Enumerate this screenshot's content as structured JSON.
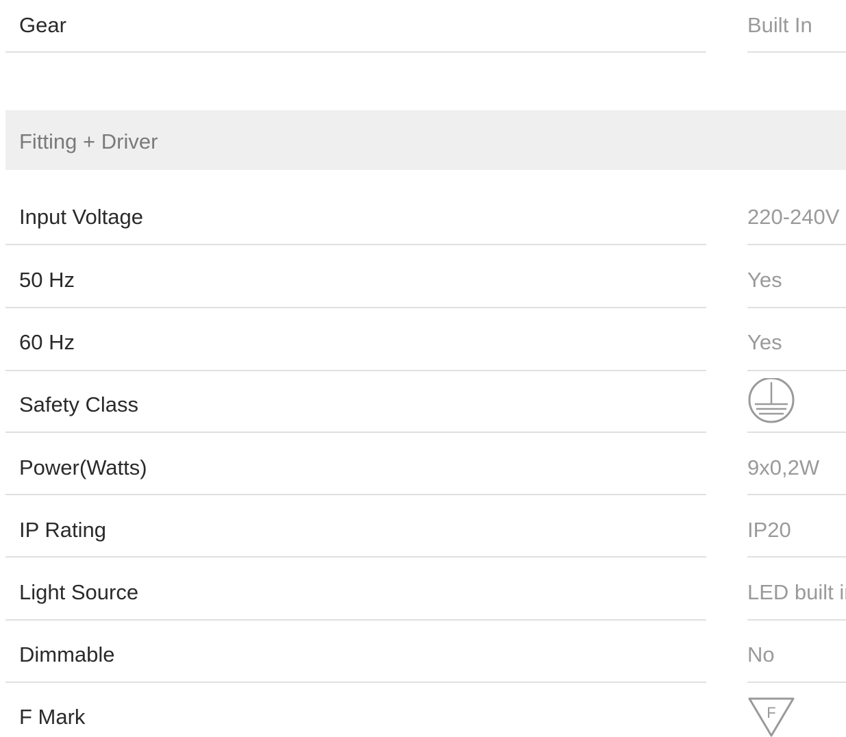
{
  "top_row": {
    "label": "Gear",
    "value": "Built In"
  },
  "section": {
    "title": "Fitting + Driver"
  },
  "rows": [
    {
      "label": "Input Voltage",
      "value": "220-240V"
    },
    {
      "label": "50 Hz",
      "value": "Yes"
    },
    {
      "label": "60 Hz",
      "value": "Yes"
    },
    {
      "label": "Safety Class",
      "icon": "earth-ground-icon"
    },
    {
      "label": "Power(Watts)",
      "value": "9x0,2W"
    },
    {
      "label": "IP Rating",
      "value": "IP20"
    },
    {
      "label": "Light Source",
      "value": "LED built in"
    },
    {
      "label": "Dimmable",
      "value": "No"
    },
    {
      "label": "F Mark",
      "icon": "f-mark-icon",
      "icon_text": "F"
    }
  ],
  "colors": {
    "label": "#2a2a2a",
    "value": "#9a9a9a",
    "rule": "#e0e0e0",
    "section_bg": "#efefef"
  }
}
